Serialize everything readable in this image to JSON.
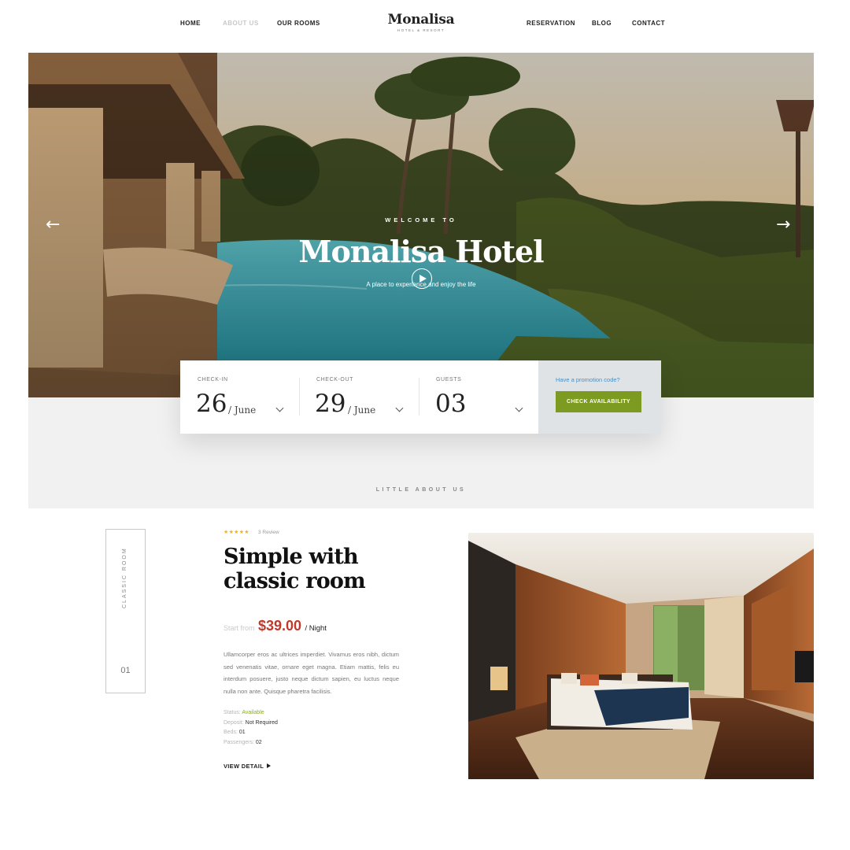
{
  "nav": {
    "left": [
      "HOME",
      "ABOUT US",
      "OUR ROOMS"
    ],
    "right": [
      "RESERVATION",
      "BLOG",
      "CONTACT"
    ],
    "active_dim": "ABOUT US",
    "logo_title": "Monalisa",
    "logo_sub": "HOTEL & RESORT"
  },
  "hero": {
    "welcome": "WELCOME TO",
    "title": "Monalisa Hotel",
    "subtitle": "A place to experience and enjoy the life",
    "prev_icon": "←",
    "next_icon": "→"
  },
  "booking": {
    "checkin_label": "CHECK-IN",
    "checkin_day": "26",
    "checkin_month": "/ June",
    "checkout_label": "CHECK-OUT",
    "checkout_day": "29",
    "checkout_month": "/ June",
    "guests_label": "GUESTS",
    "guests_value": "03",
    "promo_text": "Have a promotion code?",
    "check_button": "CHECK AVAILABILITY"
  },
  "section": {
    "little_about": "LITTLE ABOUT US"
  },
  "room": {
    "side_label": "CLASSIC ROOM",
    "side_number": "01",
    "stars": "★★★★★",
    "rating_value": 5,
    "review": "3 Review",
    "title": "Simple with classic room",
    "start_from": "Start from",
    "price": "$39.00",
    "per_night": "/ Night",
    "description": "Ullamcorper eros ac ultrices imperdiet. Vivamus eros nibh, dictum sed venenatis vitae, ornare eget magna. Etiam mattis, felis eu interdum posuere, justo neque dictum sapien, eu luctus neque nulla non ante. Quisque pharetra facilisis.",
    "specs": [
      {
        "key": "Status:",
        "value": "Available",
        "green": true
      },
      {
        "key": "Deposit:",
        "value": "Not Required",
        "green": false
      },
      {
        "key": "Beds:",
        "value": "01",
        "green": false
      },
      {
        "key": "Passengers:",
        "value": "02",
        "green": false
      }
    ],
    "view_detail": "VIEW DETAIL"
  },
  "colors": {
    "accent_green": "#7d9b21",
    "price_red": "#c0392b",
    "star_gold": "#f0b41b",
    "promo_blue": "#4a8fc2"
  }
}
